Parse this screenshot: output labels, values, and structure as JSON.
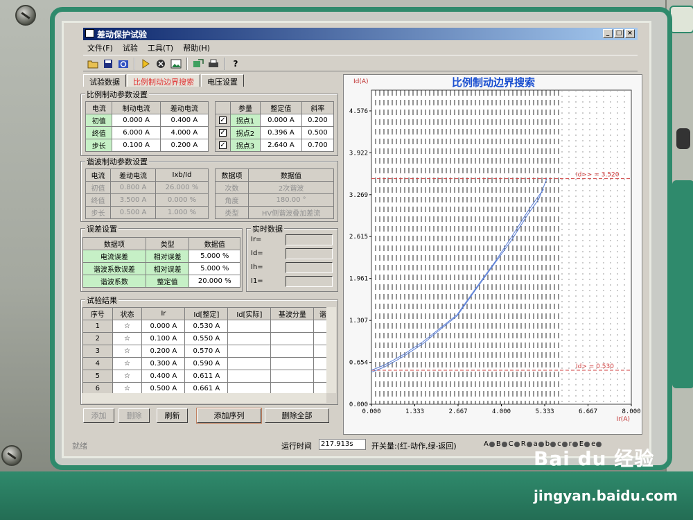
{
  "window": {
    "title": "差动保护试验",
    "min": "_",
    "max": "□",
    "close": "×"
  },
  "menu": [
    "文件(F)",
    "试验",
    "工具(T)",
    "帮助(H)"
  ],
  "toolbar": {
    "icons": [
      "open-icon",
      "save-icon",
      "refresh-icon",
      "play-icon",
      "stop-icon",
      "image-icon",
      "export-icon",
      "print-icon",
      "help-icon"
    ],
    "help_label": "?"
  },
  "tabs": [
    "试验数据",
    "比例制动边界搜索",
    "电压设置"
  ],
  "ratio_params": {
    "title": "比例制动参数设置",
    "headers": [
      "电流",
      "制动电流",
      "差动电流"
    ],
    "rows": [
      {
        "name": "初值",
        "brake": "0.000 A",
        "diff": "0.400 A"
      },
      {
        "name": "终值",
        "brake": "6.000 A",
        "diff": "4.000 A"
      },
      {
        "name": "步长",
        "brake": "0.100 A",
        "diff": "0.200 A"
      }
    ],
    "pt_headers": [
      "参量",
      "整定值",
      "斜率"
    ],
    "points": [
      {
        "name": "拐点1",
        "value": "0.000 A",
        "slope": "0.200",
        "checked": "✓"
      },
      {
        "name": "拐点2",
        "value": "0.396 A",
        "slope": "0.500",
        "checked": "✓"
      },
      {
        "name": "拐点3",
        "value": "2.640 A",
        "slope": "0.700",
        "checked": "✓"
      }
    ]
  },
  "harmonic_params": {
    "title": "谐波制动参数设置",
    "headers": [
      "电流",
      "差动电流",
      "Ixb/Id"
    ],
    "rows": [
      {
        "name": "初值",
        "diff": "0.800 A",
        "ratio": "26.000 %"
      },
      {
        "name": "终值",
        "diff": "3.500 A",
        "ratio": "0.000 %"
      },
      {
        "name": "步长",
        "diff": "0.500 A",
        "ratio": "1.000 %"
      }
    ],
    "data_headers": [
      "数据项",
      "数据值"
    ],
    "data": [
      {
        "name": "次数",
        "value": "2次谐波"
      },
      {
        "name": "角度",
        "value": "180.00 °"
      },
      {
        "name": "类型",
        "value": "HV侧谐波叠加差流"
      }
    ]
  },
  "error_settings": {
    "title": "误差设置",
    "headers": [
      "数据项",
      "类型",
      "数据值"
    ],
    "rows": [
      {
        "name": "电流误差",
        "type": "相对误差",
        "value": "5.000 %"
      },
      {
        "name": "谐波系数误差",
        "type": "相对误差",
        "value": "5.000 %"
      },
      {
        "name": "谐波系数",
        "type": "整定值",
        "value": "20.000 %"
      }
    ]
  },
  "realtime": {
    "title": "实时数据",
    "labels": [
      "Ir=",
      "Id=",
      "Ih=",
      "I1="
    ]
  },
  "results": {
    "title": "试验结果",
    "headers": [
      "序号",
      "状态",
      "Ir",
      "Id[整定]",
      "Id[实际]",
      "基波分量",
      "谐"
    ],
    "rows": [
      {
        "no": "1",
        "status": "☆",
        "ir": "0.000 A",
        "id": "0.530 A"
      },
      {
        "no": "2",
        "status": "☆",
        "ir": "0.100 A",
        "id": "0.550 A"
      },
      {
        "no": "3",
        "status": "☆",
        "ir": "0.200 A",
        "id": "0.570 A"
      },
      {
        "no": "4",
        "status": "☆",
        "ir": "0.300 A",
        "id": "0.590 A"
      },
      {
        "no": "5",
        "status": "☆",
        "ir": "0.400 A",
        "id": "0.611 A"
      },
      {
        "no": "6",
        "status": "☆",
        "ir": "0.500 A",
        "id": "0.661 A"
      }
    ]
  },
  "buttons": {
    "add": "添加",
    "delete": "删除",
    "refresh": "刷新",
    "add_seq": "添加序列",
    "delete_all": "删除全部"
  },
  "status": {
    "ready": "就绪",
    "runtime_label": "运行时间",
    "runtime": "217.913s",
    "switch_label": "开关量:(红-动作,绿-返回)",
    "switches": [
      "A",
      "B",
      "C",
      "R",
      "a",
      "b",
      "c",
      "r",
      "E",
      "e"
    ]
  },
  "chart_data": {
    "type": "line",
    "title": "比例制动边界搜索",
    "ylabel": "Id(A)",
    "xlabel": "Ir(A)",
    "xlim": [
      0,
      8
    ],
    "ylim": [
      0,
      4.9
    ],
    "x_ticks": [
      "0.000",
      "1.333",
      "2.667",
      "4.000",
      "5.333",
      "6.667",
      "8.000"
    ],
    "y_ticks": [
      "0.000",
      "0.654",
      "1.307",
      "1.961",
      "2.615",
      "3.269",
      "3.922",
      "4.576"
    ],
    "annotations": [
      {
        "text": "Id>> = 3.520",
        "y": 3.52
      },
      {
        "text": "Id> = 0.530",
        "y": 0.53
      }
    ],
    "series": [
      {
        "values": [
          [
            0,
            0.53
          ],
          [
            0.4,
            0.611
          ],
          [
            1.0,
            0.78
          ],
          [
            1.6,
            0.98
          ],
          [
            2.2,
            1.22
          ],
          [
            2.64,
            1.4
          ],
          [
            3.2,
            1.8
          ],
          [
            3.8,
            2.22
          ],
          [
            4.3,
            2.6
          ],
          [
            4.8,
            3.0
          ],
          [
            5.1,
            3.22
          ],
          [
            5.3,
            3.35
          ]
        ]
      },
      {
        "values": [
          [
            0,
            0.5
          ],
          [
            0.4,
            0.58
          ],
          [
            1.0,
            0.75
          ],
          [
            1.6,
            0.95
          ],
          [
            2.2,
            1.2
          ],
          [
            2.64,
            1.38
          ],
          [
            3.2,
            1.78
          ],
          [
            3.8,
            2.2
          ],
          [
            4.3,
            2.55
          ],
          [
            4.8,
            2.95
          ],
          [
            5.15,
            3.2
          ],
          [
            5.4,
            3.52
          ]
        ]
      }
    ],
    "colors": {
      "line": "#5a7fd8",
      "ref": "#d04040",
      "grid": "#2a2a2a"
    }
  },
  "watermark": {
    "brand": "Bai du 经验",
    "url": "jingyan.baidu.com"
  }
}
